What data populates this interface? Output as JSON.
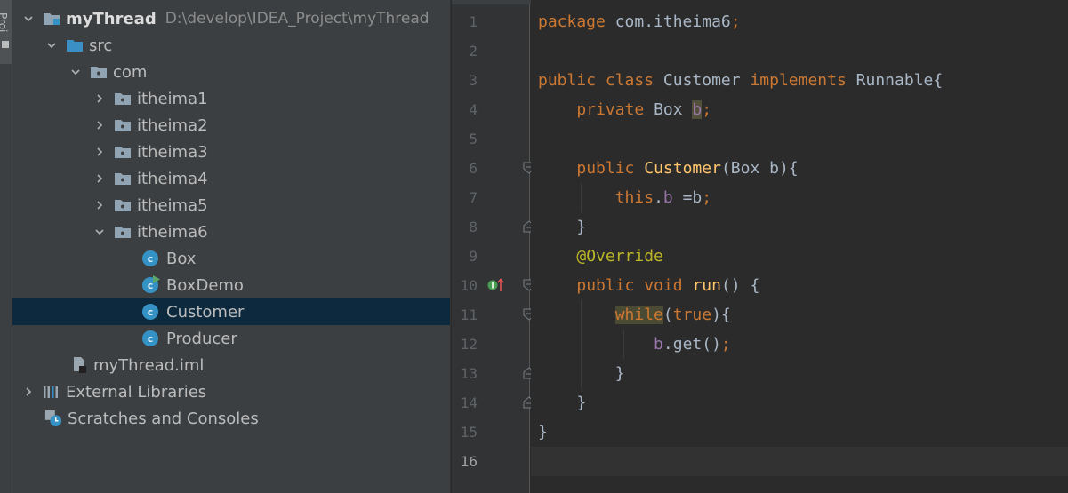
{
  "side_strip": {
    "label": "Proj"
  },
  "tree": {
    "root": {
      "name": "myThread",
      "path": "D:\\develop\\IDEA_Project\\myThread"
    },
    "src": "src",
    "com": "com",
    "packages": [
      "itheima1",
      "itheima2",
      "itheima3",
      "itheima4",
      "itheima5",
      "itheima6"
    ],
    "classes": [
      "Box",
      "BoxDemo",
      "Customer",
      "Producer"
    ],
    "selected": "Customer",
    "class_icon_letter": "c",
    "iml": "myThread.iml",
    "external_libraries": "External Libraries",
    "scratches": "Scratches and Consoles"
  },
  "gutter": {
    "line_numbers": [
      "1",
      "2",
      "3",
      "4",
      "5",
      "6",
      "7",
      "8",
      "9",
      "10",
      "11",
      "12",
      "13",
      "14",
      "15",
      "16"
    ],
    "current_line": "16"
  },
  "code": {
    "l1_kw": "package",
    "l1_rest": " com.itheima6",
    "l1_semi": ";",
    "l3_kw1": "public",
    "l3_kw2": "class",
    "l3_name": "Customer",
    "l3_kw3": "implements",
    "l3_iface": "Runnable{",
    "l4_kw": "private",
    "l4_type": "Box",
    "l4_field": "b",
    "l4_semi": ";",
    "l6_kw": "public",
    "l6_fn": "Customer",
    "l6_params": "(Box b){",
    "l7_this": "this",
    "l7_dot": ".",
    "l7_field": "b",
    "l7_assign": " =b",
    "l7_semi": ";",
    "l8": "}",
    "l9_ann": "@Override",
    "l10_kw1": "public",
    "l10_kw2": "void",
    "l10_fn": "run",
    "l10_rest": "() {",
    "l11_kw": "while",
    "l11_paren": "(",
    "l11_true": "true",
    "l11_rest": "){",
    "l12_obj": "b",
    "l12_call": ".get()",
    "l12_semi": ";",
    "l13": "}",
    "l14": "}",
    "l15": "}"
  },
  "colors": {
    "keyword": "#cc7832",
    "method": "#ffc66d",
    "field": "#9876aa",
    "annotation": "#bbb529",
    "text": "#a9b7c6",
    "selection": "#0d293e"
  }
}
